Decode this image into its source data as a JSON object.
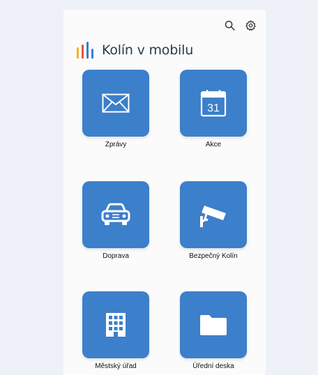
{
  "app": {
    "title": "Kolín v mobilu",
    "accent_color": "#3c7fca",
    "logo_colors": [
      "#f2b233",
      "#e5533c",
      "#3a7bd5",
      "#3a7bd5"
    ]
  },
  "toolbar": {
    "search_icon": "search-icon",
    "settings_icon": "gear-icon"
  },
  "tiles": [
    {
      "label": "Zprávy",
      "icon": "envelope-icon"
    },
    {
      "label": "Akce",
      "icon": "calendar-icon",
      "calendar_day": "31"
    },
    {
      "label": "Doprava",
      "icon": "car-icon"
    },
    {
      "label": "Bezpečný Kolín",
      "icon": "security-camera-icon"
    },
    {
      "label": "Městský úřad",
      "icon": "building-icon"
    },
    {
      "label": "Úřední deska",
      "icon": "folder-icon"
    }
  ]
}
